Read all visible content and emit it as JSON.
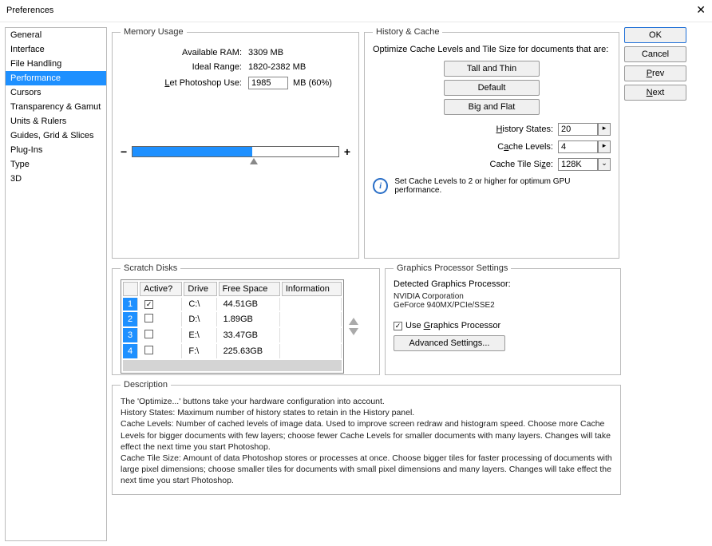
{
  "title": "Preferences",
  "sidebar": {
    "items": [
      {
        "label": "General"
      },
      {
        "label": "Interface"
      },
      {
        "label": "File Handling"
      },
      {
        "label": "Performance"
      },
      {
        "label": "Cursors"
      },
      {
        "label": "Transparency & Gamut"
      },
      {
        "label": "Units & Rulers"
      },
      {
        "label": "Guides, Grid & Slices"
      },
      {
        "label": "Plug-Ins"
      },
      {
        "label": "Type"
      },
      {
        "label": "3D"
      }
    ],
    "selected_index": 3
  },
  "buttons": {
    "ok": "OK",
    "cancel": "Cancel",
    "prev": "Prev",
    "next": "Next"
  },
  "memory": {
    "legend": "Memory Usage",
    "available_label": "Available RAM:",
    "available_value": "3309 MB",
    "ideal_label": "Ideal Range:",
    "ideal_value": "1820-2382 MB",
    "let_label": "Let Photoshop Use:",
    "let_value": "1985",
    "let_suffix": "MB (60%)"
  },
  "history": {
    "legend": "History & Cache",
    "intro": "Optimize Cache Levels and Tile Size for documents that are:",
    "btn_tall": "Tall and Thin",
    "btn_default": "Default",
    "btn_big": "Big and Flat",
    "states_label": "History States:",
    "states_value": "20",
    "levels_label": "Cache Levels:",
    "levels_value": "4",
    "tile_label": "Cache Tile Size:",
    "tile_value": "128K",
    "tip": "Set Cache Levels to 2 or higher for optimum GPU performance."
  },
  "scratch": {
    "legend": "Scratch Disks",
    "headers": [
      "Active?",
      "Drive",
      "Free Space",
      "Information"
    ],
    "rows": [
      {
        "n": "1",
        "active": true,
        "drive": "C:\\",
        "free": "44.51GB",
        "info": ""
      },
      {
        "n": "2",
        "active": false,
        "drive": "D:\\",
        "free": "1.89GB",
        "info": ""
      },
      {
        "n": "3",
        "active": false,
        "drive": "E:\\",
        "free": "33.47GB",
        "info": ""
      },
      {
        "n": "4",
        "active": false,
        "drive": "F:\\",
        "free": "225.63GB",
        "info": ""
      }
    ]
  },
  "gpu": {
    "legend": "Graphics Processor Settings",
    "detected_label": "Detected Graphics Processor:",
    "vendor": "NVIDIA Corporation",
    "model": "GeForce 940MX/PCIe/SSE2",
    "use_label": "Use Graphics Processor",
    "use_checked": true,
    "advanced": "Advanced Settings..."
  },
  "description": {
    "legend": "Description",
    "text": "The 'Optimize...' buttons take your hardware configuration into account.\nHistory States: Maximum number of history states to retain in the History panel.\nCache Levels: Number of cached levels of image data.  Used to improve screen redraw and histogram speed.  Choose more Cache Levels for bigger documents with few layers; choose fewer Cache Levels for smaller documents with many layers. Changes will take effect the next time you start Photoshop.\nCache Tile Size: Amount of data Photoshop stores or processes at once. Choose bigger tiles for faster processing of documents with large pixel dimensions; choose smaller tiles for documents with small pixel dimensions and many layers. Changes will take effect the next time you start Photoshop."
  }
}
